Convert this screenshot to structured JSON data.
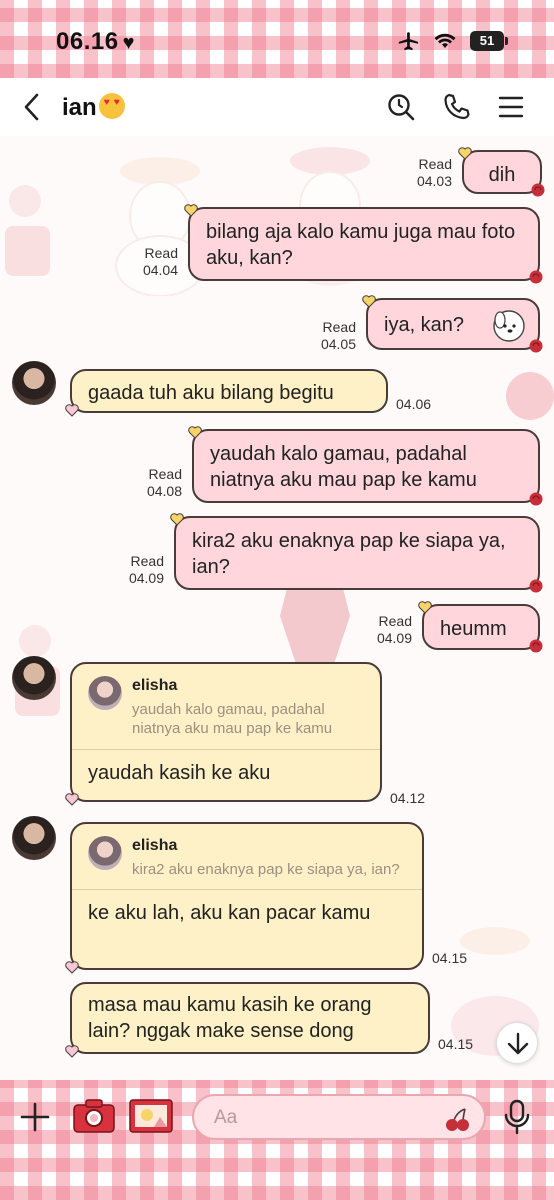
{
  "status_bar": {
    "time": "06.16",
    "battery": "51"
  },
  "header": {
    "contact_name": "ian"
  },
  "messages": [
    {
      "text": "dih",
      "status": "Read",
      "time": "04.03"
    },
    {
      "text": "bilang aja kalo kamu juga mau foto aku, kan?",
      "status": "Read",
      "time": "04.04"
    },
    {
      "text": "iya, kan?",
      "status": "Read",
      "time": "04.05"
    },
    {
      "text": "gaada tuh aku bilang begitu",
      "time": "04.06"
    },
    {
      "text": "yaudah kalo gamau, padahal niatnya aku mau pap ke kamu",
      "status": "Read",
      "time": "04.08"
    },
    {
      "text": "kira2 aku enaknya pap ke siapa ya, ian?",
      "status": "Read",
      "time": "04.09"
    },
    {
      "text": "heumm",
      "status": "Read",
      "time": "04.09"
    },
    {
      "reply_name": "elisha",
      "reply_text": "yaudah kalo gamau, padahal niatnya aku mau pap ke kamu",
      "text": "yaudah kasih ke aku",
      "time": "04.12"
    },
    {
      "reply_name": "elisha",
      "reply_text": "kira2 aku enaknya pap ke siapa ya, ian?",
      "text": "ke aku lah, aku kan pacar kamu",
      "time": "04.15"
    },
    {
      "text": "masa mau kamu kasih ke orang lain? nggak make sense dong",
      "time": "04.15"
    }
  ],
  "input": {
    "placeholder": "Aa"
  },
  "icons": {
    "back": "chevron-left-icon",
    "search": "search-icon",
    "call": "phone-icon",
    "menu": "hamburger-menu-icon",
    "plus": "plus-icon",
    "camera": "camera-icon",
    "gallery": "photo-icon",
    "sticker": "cherry-icon",
    "mic": "microphone-icon",
    "scroll": "arrow-down-icon"
  },
  "colors": {
    "outgoing_bubble": "#ffd6dc",
    "incoming_bubble": "#fff1c7",
    "gingham": "#ef788c"
  }
}
